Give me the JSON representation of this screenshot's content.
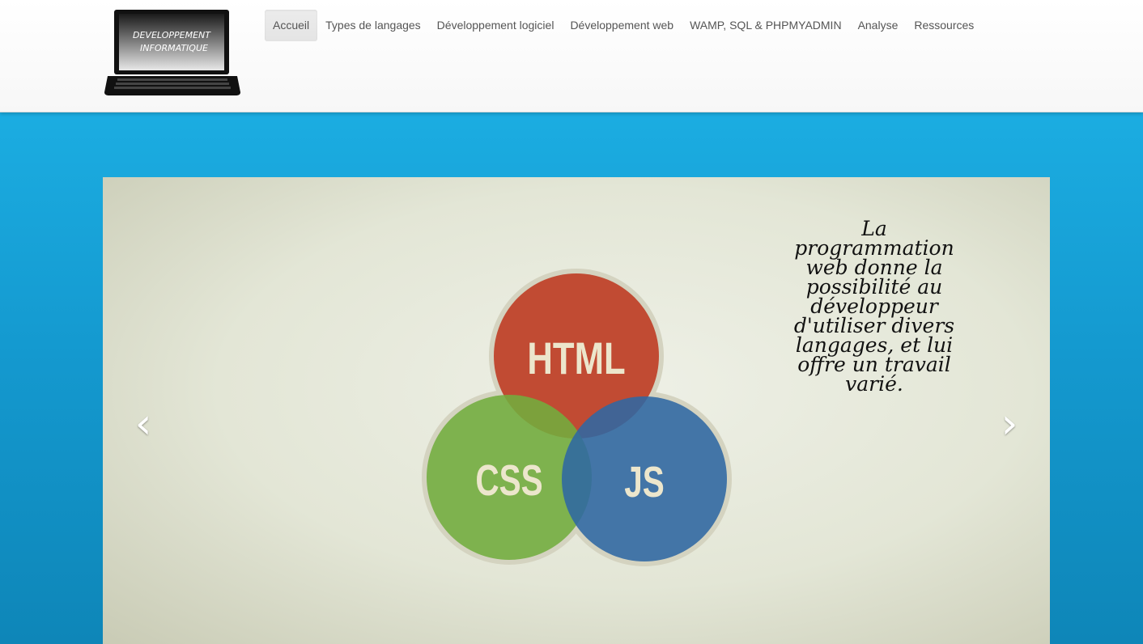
{
  "logo": {
    "line1": "DEVELOPPEMENT",
    "line2": "INFORMATIQUE"
  },
  "nav": {
    "items": [
      {
        "label": "Accueil",
        "active": true
      },
      {
        "label": "Types de langages",
        "active": false
      },
      {
        "label": "Développement logiciel",
        "active": false
      },
      {
        "label": "Développement web",
        "active": false
      },
      {
        "label": "WAMP, SQL & PHPMYADMIN",
        "active": false
      },
      {
        "label": "Analyse",
        "active": false
      },
      {
        "label": "Ressources",
        "active": false
      }
    ]
  },
  "carousel": {
    "caption": "La programmation web donne la possibilité au développeur d'utiliser divers langages, et lui offre un travail varié.",
    "venn": {
      "html_label": "HTML",
      "css_label": "CSS",
      "js_label": "JS"
    },
    "prev_icon": "chevron-left-icon",
    "next_icon": "chevron-right-icon"
  },
  "colors": {
    "background_top": "#1fb6ea",
    "background_bottom": "#0e86b8",
    "html_circle": "#c0432b",
    "css_circle": "#72ad3d",
    "js_circle": "#2f68a3"
  }
}
